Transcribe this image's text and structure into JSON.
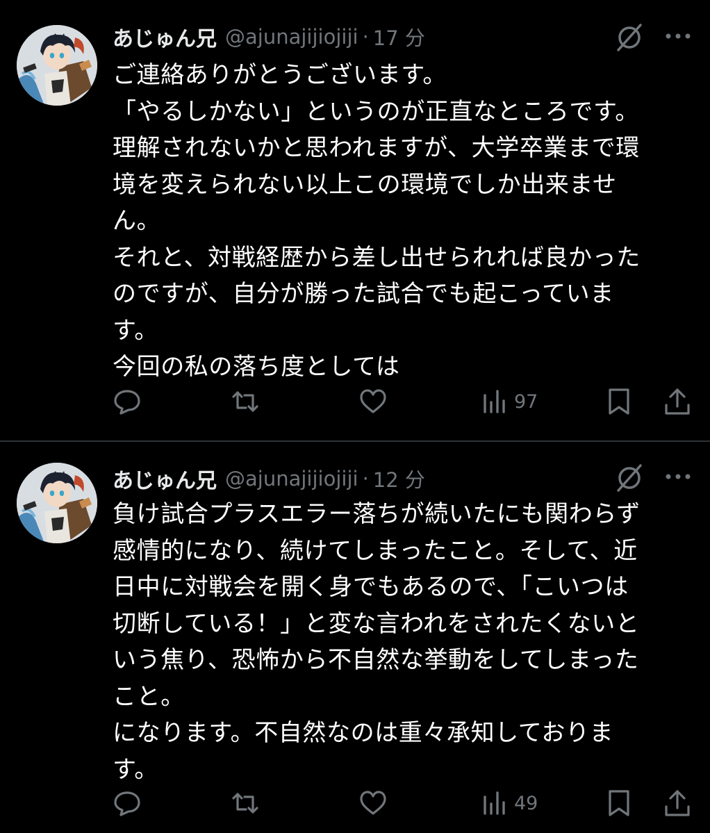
{
  "tweets": [
    {
      "author_name": "あじゅん兄",
      "handle": "@ajunajijiojiji",
      "separator": "·",
      "time": "17 分",
      "lines": [
        "ご連絡ありがとうございます。",
        "「やるしかない」というのが正直なところです。",
        "理解されないかと思われますが、大学卒業まで環",
        "境を変えられない以上この環境でしか出来ませ",
        "ん。",
        "それと、対戦経歴から差し出せられれば良かった",
        "のですが、自分が勝った試合でも起こっていま",
        "す。",
        "今回の私の落ち度としては"
      ],
      "views": "97"
    },
    {
      "author_name": "あじゅん兄",
      "handle": "@ajunajijiojiji",
      "separator": "·",
      "time": "12 分",
      "lines": [
        "負け試合プラスエラー落ちが続いたにも関わらず",
        "感情的になり、続けてしまったこと。そして、近",
        "日中に対戦会を開く身でもあるので、「こいつは",
        "切断している！」と変な言われをされたくないと",
        "いう焦り、恐怖から不自然な挙動をしてしまった",
        "こと。",
        "になります。不自然なのは重々承知しておりま",
        "す。"
      ],
      "views": "49"
    }
  ],
  "colors": {
    "background": "#000000",
    "text": "#ffffff",
    "muted": "#71767b",
    "divider": "#2f3336"
  },
  "icons": {
    "reply": "reply-icon",
    "retweet": "retweet-icon",
    "like": "heart-icon",
    "views": "analytics-icon",
    "bookmark": "bookmark-icon",
    "share": "share-icon",
    "grok": "grok-icon",
    "more": "more-icon"
  }
}
